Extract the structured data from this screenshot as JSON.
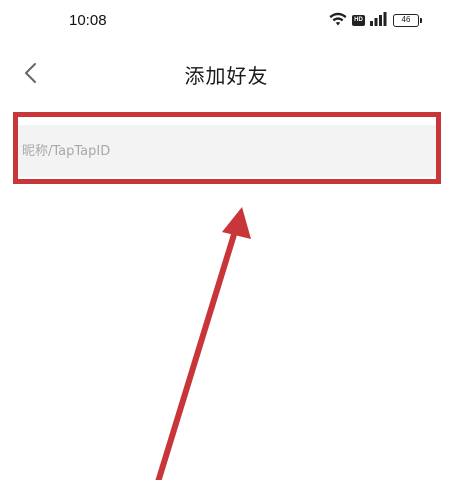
{
  "status_bar": {
    "time": "10:08",
    "battery_level": "46",
    "hd_label": "HD"
  },
  "nav": {
    "title": "添加好友"
  },
  "search": {
    "placeholder": "昵称/TapTapID",
    "value": ""
  },
  "annotation": {
    "color": "#c8363a"
  },
  "icons": {
    "back": "chevron-left-icon",
    "wifi": "wifi-icon",
    "signal": "cellular-signal-icon",
    "battery": "battery-icon"
  }
}
